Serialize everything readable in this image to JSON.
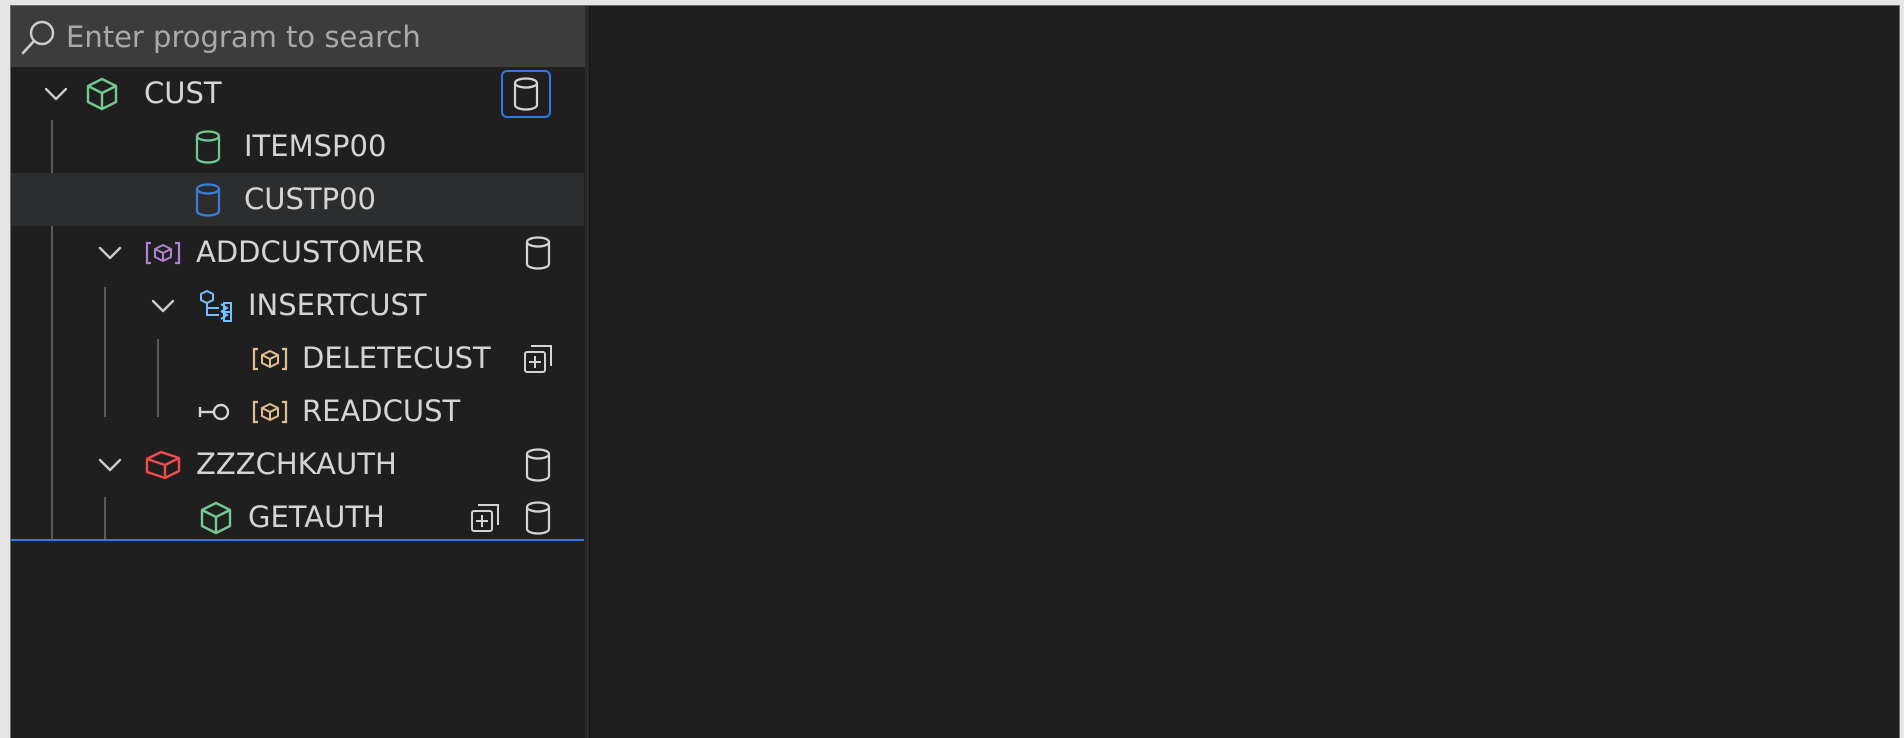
{
  "search": {
    "placeholder": "Enter program to search",
    "value": ""
  },
  "tree": {
    "root": {
      "label": "CUST",
      "icon": "box-icon",
      "color": "#73c991",
      "expanded": true
    },
    "items": [
      {
        "label": "ITEMSP00",
        "icon": "database-icon",
        "color": "#73c991"
      },
      {
        "label": "CUSTP00",
        "icon": "database-icon",
        "color": "#3b7ddd",
        "selected": true
      },
      {
        "label": "ADDCUSTOMER",
        "icon": "bracketed-box-icon",
        "color": "#b180d7",
        "expanded": true
      },
      {
        "label": "INSERTCUST",
        "icon": "type-hierarchy-icon",
        "color": "#75beff",
        "expanded": true
      },
      {
        "label": "DELETECUST",
        "icon": "bracketed-box-icon",
        "color": "#e2c08d"
      },
      {
        "label": "READCUST",
        "icon": "bracketed-box-icon",
        "color": "#e2c08d"
      },
      {
        "label": "ZZZCHKAUTH",
        "icon": "box-icon",
        "color": "#f14c4c",
        "expanded": true
      },
      {
        "label": "GETAUTH",
        "icon": "box-icon",
        "color": "#73c991"
      }
    ]
  },
  "colors": {
    "background": "#1f1f1f",
    "search_background": "#3c3c3c",
    "selection": "#2c2d2e",
    "focus_accent": "#2f7ae5",
    "text": "#d4d4d4"
  }
}
